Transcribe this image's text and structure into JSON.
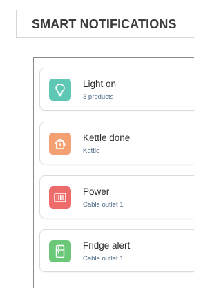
{
  "header": {
    "title": "SMART NOTIFICATIONS"
  },
  "notifications": [
    {
      "title": "Light on",
      "subtitle": "3 products",
      "icon": "lightbulb-icon",
      "color": "#5ec8b4"
    },
    {
      "title": "Kettle done",
      "subtitle": "Kettle",
      "icon": "kettle-icon",
      "color": "#f3a172"
    },
    {
      "title": "Power",
      "subtitle": "Cable outlet 1",
      "icon": "power-outlet-icon",
      "color": "#ee6b6b"
    },
    {
      "title": "Fridge alert",
      "subtitle": "Cable outlet 1",
      "icon": "fridge-icon",
      "color": "#6cc879"
    }
  ]
}
